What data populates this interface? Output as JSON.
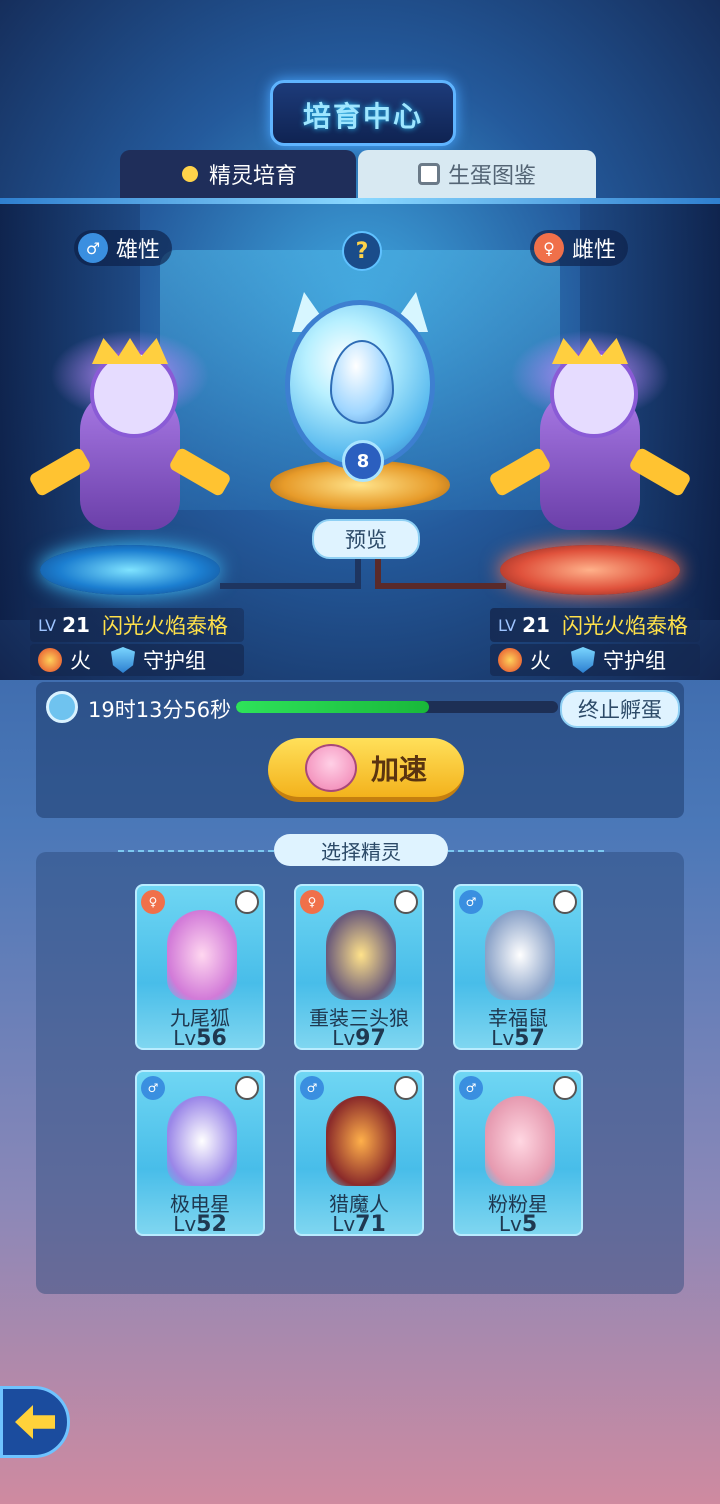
{
  "header": {
    "title": "培育中心"
  },
  "tabs": [
    {
      "label": "精灵培育",
      "active": true
    },
    {
      "label": "生蛋图鉴",
      "active": false
    }
  ],
  "parents": {
    "male": {
      "gender_label": "雄性",
      "lv_prefix": "LV",
      "level": "21",
      "name": "闪光火焰泰格",
      "element": "火",
      "group": "守护组"
    },
    "female": {
      "gender_label": "雌性",
      "lv_prefix": "LV",
      "level": "21",
      "name": "闪光火焰泰格",
      "element": "火",
      "group": "守护组"
    }
  },
  "help_label": "?",
  "egg_badge": "8",
  "preview_label": "预览",
  "hatch": {
    "time_left": "19时13分56秒",
    "progress": 0.6,
    "stop_label": "终止孵蛋",
    "speed_label": "加速"
  },
  "select": {
    "title": "选择精灵",
    "pets": [
      {
        "name": "九尾狐",
        "lv_prefix": "Lv",
        "level": "56",
        "gender": "female"
      },
      {
        "name": "重装三头狼",
        "lv_prefix": "Lv",
        "level": "97",
        "gender": "female"
      },
      {
        "name": "幸福鼠",
        "lv_prefix": "Lv",
        "level": "57",
        "gender": "male"
      },
      {
        "name": "极电星",
        "lv_prefix": "Lv",
        "level": "52",
        "gender": "male"
      },
      {
        "name": "猎魔人",
        "lv_prefix": "Lv",
        "level": "71",
        "gender": "male"
      },
      {
        "name": "粉粉星",
        "lv_prefix": "Lv",
        "level": "5",
        "gender": "male"
      }
    ]
  },
  "colors": {
    "male": "#3a8fe0",
    "female": "#f0704a",
    "accent": "#ffd34a",
    "progress": "#2ee35a"
  }
}
